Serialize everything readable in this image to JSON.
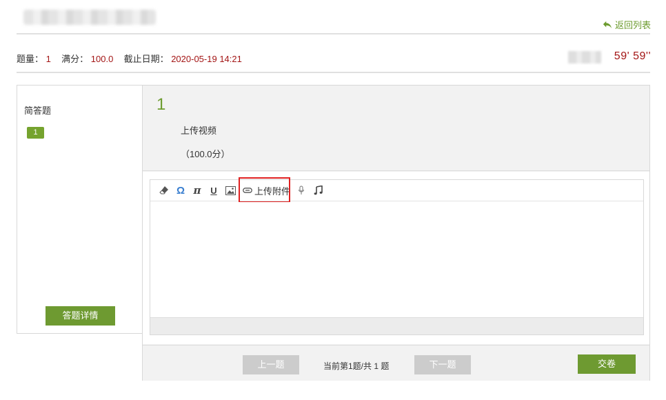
{
  "header": {
    "back_label": "返回列表"
  },
  "info": {
    "count_label": "题量：",
    "count_value": "1",
    "score_label": "满分：",
    "score_value": "100.0",
    "deadline_label": "截止日期：",
    "deadline_value": "2020-05-19 14:21",
    "timer": "59' 59''"
  },
  "sidebar": {
    "section_title": "简答题",
    "question_badges": [
      "1"
    ],
    "detail_button": "答题详情"
  },
  "question": {
    "number": "1",
    "text": "上传视频",
    "score": "（100.0分）"
  },
  "editor": {
    "toolbar": [
      {
        "icon": "eraser-icon"
      },
      {
        "icon": "omega-icon",
        "glyph": "Ω"
      },
      {
        "icon": "pi-icon",
        "glyph": "π"
      },
      {
        "icon": "underline-icon",
        "glyph": "U"
      },
      {
        "icon": "image-icon"
      },
      {
        "icon": "paperclip-icon",
        "label": "上传附件"
      },
      {
        "icon": "microphone-icon"
      },
      {
        "icon": "music-note-icon"
      }
    ],
    "upload_attachment_label": "上传附件",
    "highlight_color": "#e02020"
  },
  "footer": {
    "prev_label": "上一题",
    "page_info": "当前第1题/共 1 题",
    "next_label": "下一题",
    "submit_label": "交卷"
  },
  "colors": {
    "accent_green": "#6e9a31",
    "alert_red": "#a31515",
    "disabled_gray": "#cccccc"
  }
}
